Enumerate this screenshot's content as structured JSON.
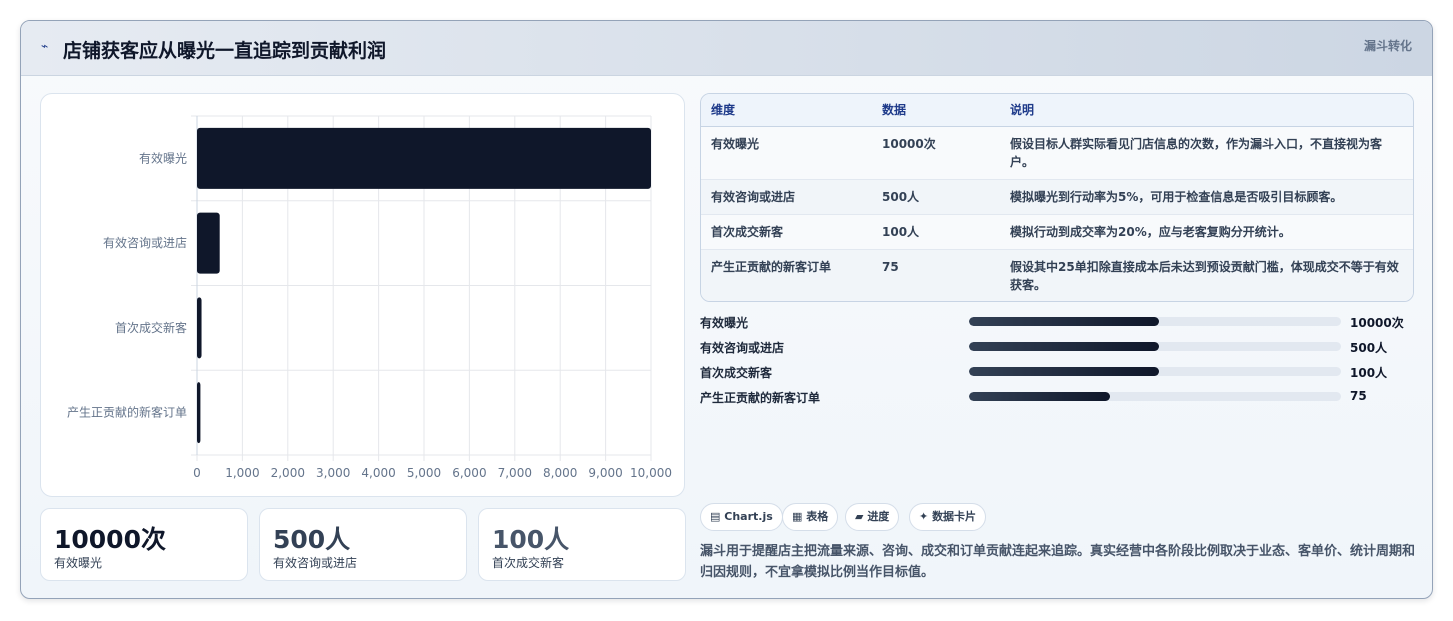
{
  "header": {
    "icon": "trend-icon",
    "title": "店铺获客应从曝光一直追踪到贡献利润",
    "tag": "漏斗转化"
  },
  "chart_data": {
    "type": "bar",
    "orientation": "horizontal",
    "categories": [
      "有效曝光",
      "有效咨询或进店",
      "首次成交新客",
      "产生正贡献的新客订单"
    ],
    "values": [
      10000,
      500,
      100,
      75
    ],
    "xlim": [
      0,
      10000
    ],
    "xticks": [
      "0",
      "1,000",
      "2,000",
      "3,000",
      "4,000",
      "5,000",
      "6,000",
      "7,000",
      "8,000",
      "9,000",
      "10,000"
    ],
    "bar_color": "#0f172a",
    "grid": true
  },
  "stats": [
    {
      "value": "10000次",
      "label": "有效曝光",
      "color": "#0f172a"
    },
    {
      "value": "500人",
      "label": "有效咨询或进店",
      "color": "#334155"
    },
    {
      "value": "100人",
      "label": "首次成交新客",
      "color": "#475569"
    }
  ],
  "table": {
    "headers": [
      "维度",
      "数据",
      "说明"
    ],
    "rows": [
      [
        "有效曝光",
        "10000次",
        "假设目标人群实际看见门店信息的次数，作为漏斗入口，不直接视为客户。"
      ],
      [
        "有效咨询或进店",
        "500人",
        "模拟曝光到行动率为5%，可用于检查信息是否吸引目标顾客。"
      ],
      [
        "首次成交新客",
        "100人",
        "模拟行动到成交率为20%，应与老客复购分开统计。"
      ],
      [
        "产生正贡献的新客订单",
        "75",
        "假设其中25单扣除直接成本后未达到预设贡献门槛，体现成交不等于有效获客。"
      ]
    ]
  },
  "progress": [
    {
      "label": "有效曝光",
      "value": "10000次",
      "level": 0.51
    },
    {
      "label": "有效咨询或进店",
      "value": "500人",
      "level": 0.51
    },
    {
      "label": "首次成交新客",
      "value": "100人",
      "level": 0.51
    },
    {
      "label": "产生正贡献的新客订单",
      "value": "75",
      "level": 0.38
    }
  ],
  "chips": [
    {
      "icon": "chart-icon",
      "glyph": "▤",
      "label": "Chart.js"
    },
    {
      "icon": "table-icon",
      "glyph": "▦",
      "label": "表格"
    },
    {
      "icon": "progress-icon",
      "glyph": "▰",
      "label": "进度"
    },
    {
      "icon": "card-icon",
      "glyph": "✦",
      "label": "数据卡片"
    }
  ],
  "note": "漏斗用于提醒店主把流量来源、咨询、成交和订单贡献连起来追踪。真实经营中各阶段比例取决于业态、客单价、统计周期和归因规则，不宜拿模拟比例当作目标值。"
}
